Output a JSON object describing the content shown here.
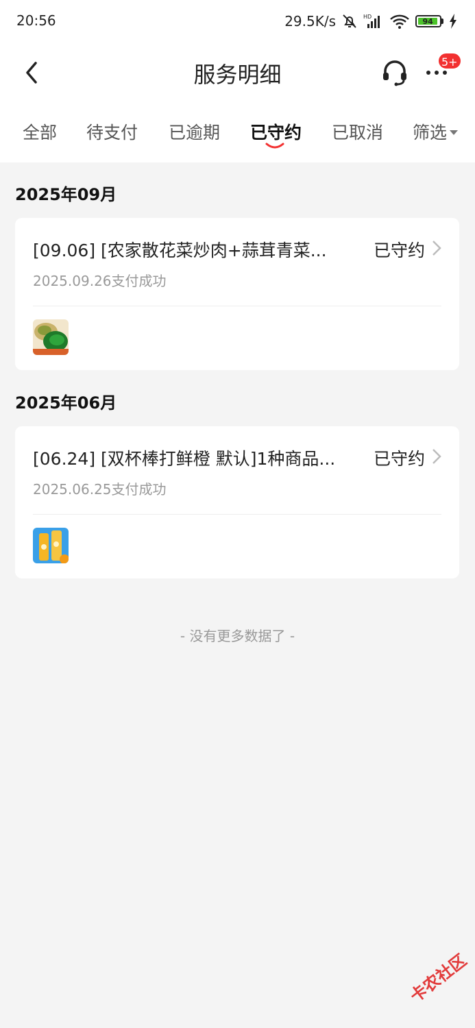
{
  "status_bar": {
    "time": "20:56",
    "net_speed": "29.5K/s",
    "battery": "94"
  },
  "header": {
    "title": "服务明细",
    "more_badge": "5+"
  },
  "tabs": [
    {
      "label": "全部"
    },
    {
      "label": "待支付"
    },
    {
      "label": "已逾期"
    },
    {
      "label": "已守约",
      "active": true
    },
    {
      "label": "已取消"
    },
    {
      "label": "筛选"
    }
  ],
  "groups": [
    {
      "month": "2025年09月",
      "order": {
        "title": "[09.06] [农家散花菜炒肉+蒜茸青菜...",
        "status": "已守约",
        "paid_info": "2025.09.26支付成功",
        "thumb_icon": "food-dish-image"
      }
    },
    {
      "month": "2025年06月",
      "order": {
        "title": "[06.24] [双杯棒打鲜橙 默认]1种商品...",
        "status": "已守约",
        "paid_info": "2025.06.25支付成功",
        "thumb_icon": "orange-drink-image"
      }
    }
  ],
  "footer": {
    "no_more": "- 没有更多数据了 -"
  },
  "watermark": {
    "text": "卡农社区"
  },
  "colors": {
    "accent_red": "#f23030",
    "background": "#f4f4f4",
    "battery_green": "#4cc42a"
  }
}
